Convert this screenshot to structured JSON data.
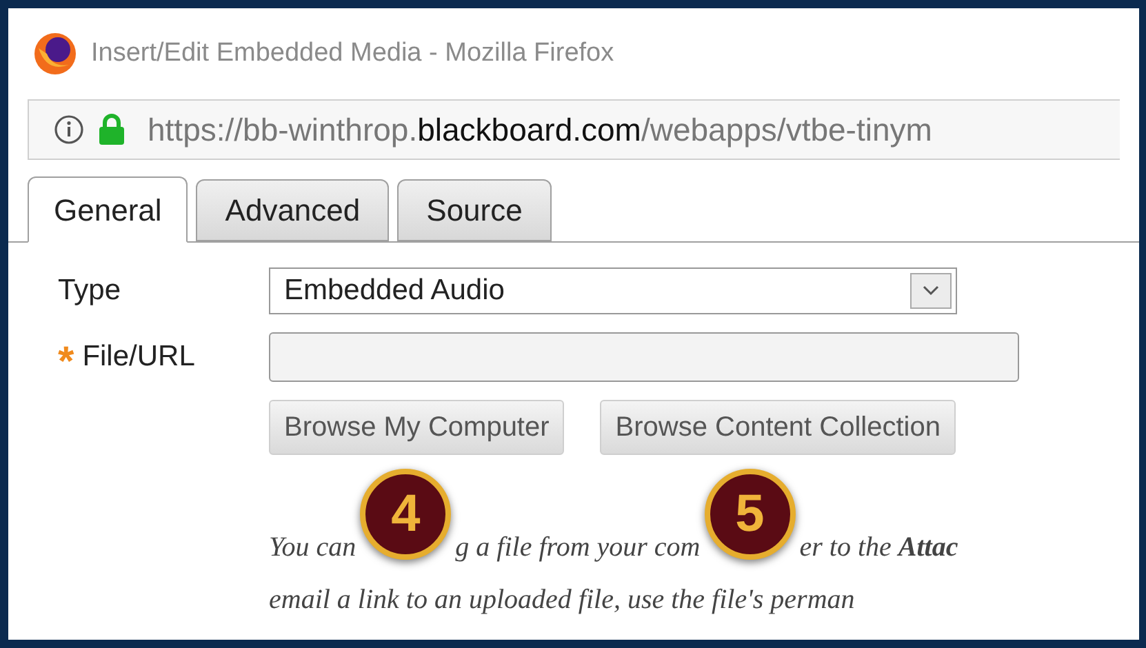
{
  "window": {
    "title": "Insert/Edit Embedded Media - Mozilla Firefox"
  },
  "address_bar": {
    "url_prefix": "https://bb-winthrop.",
    "url_domain": "blackboard.com",
    "url_path": "/webapps/vtbe-tinym"
  },
  "tabs": [
    {
      "label": "General",
      "selected": true
    },
    {
      "label": "Advanced",
      "selected": false
    },
    {
      "label": "Source",
      "selected": false
    }
  ],
  "form": {
    "type_label": "Type",
    "type_value": "Embedded Audio",
    "file_label": "File/URL",
    "required_mark": "*"
  },
  "buttons": [
    "Browse My Computer",
    "Browse Content Collection"
  ],
  "help_text": {
    "line_1": [
      "You can",
      "g a file from your com",
      "er to the **Attac**"
    ],
    "line_2": "email a link to an uploaded file, use the file's perman"
  },
  "callouts": [
    {
      "label": "4"
    },
    {
      "label": "5"
    }
  ]
}
